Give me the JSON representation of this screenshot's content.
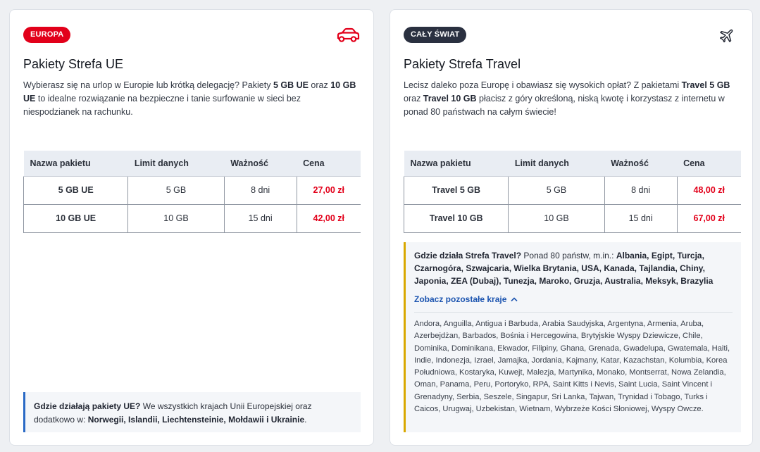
{
  "cards": {
    "eu": {
      "badge": "EUROPA",
      "icon": "car-icon",
      "title": "Pakiety Strefa UE",
      "desc": [
        {
          "t": "Wybierasz się na urlop w Europie lub krótką delegację? Pakiety ",
          "b": false
        },
        {
          "t": "5 GB UE",
          "b": true
        },
        {
          "t": " oraz ",
          "b": false
        },
        {
          "t": "10 GB UE",
          "b": true
        },
        {
          "t": " to idealne rozwiązanie na bezpieczne i tanie surfowanie w sieci bez niespodzianek na rachunku.",
          "b": false
        }
      ],
      "table": {
        "headers": [
          "Nazwa pakietu",
          "Limit danych",
          "Ważność",
          "Cena"
        ],
        "rows": [
          [
            "5 GB UE",
            "5 GB",
            "8 dni",
            "27,00 zł"
          ],
          [
            "10 GB UE",
            "10 GB",
            "15 dni",
            "42,00 zł"
          ]
        ]
      },
      "info": [
        {
          "t": "Gdzie działają pakiety UE?",
          "b": true
        },
        {
          "t": " We wszystkich krajach Unii Europejskiej oraz dodatkowo w: ",
          "b": false
        },
        {
          "t": "Norwegii, Islandii, Liechtensteinie, Mołdawii i Ukrainie",
          "b": true
        },
        {
          "t": ".",
          "b": false
        }
      ]
    },
    "travel": {
      "badge": "CAŁY ŚWIAT",
      "icon": "airplane-icon",
      "title": "Pakiety Strefa Travel",
      "desc": [
        {
          "t": "Lecisz daleko poza Europę i obawiasz się wysokich opłat? Z pakietami ",
          "b": false
        },
        {
          "t": "Travel 5 GB",
          "b": true
        },
        {
          "t": " oraz ",
          "b": false
        },
        {
          "t": "Travel 10 GB",
          "b": true
        },
        {
          "t": " płacisz z góry określoną, niską kwotę i korzystasz z internetu w ponad 80 państwach na całym świecie!",
          "b": false
        }
      ],
      "table": {
        "headers": [
          "Nazwa pakietu",
          "Limit danych",
          "Ważność",
          "Cena"
        ],
        "rows": [
          [
            "Travel 5 GB",
            "5 GB",
            "8 dni",
            "48,00 zł"
          ],
          [
            "Travel 10 GB",
            "10 GB",
            "15 dni",
            "67,00 zł"
          ]
        ]
      },
      "info": [
        {
          "t": "Gdzie działa Strefa Travel?",
          "b": true
        },
        {
          "t": " Ponad 80 państw, m.in.: ",
          "b": false
        },
        {
          "t": "Albania, Egipt, Turcja, Czarnogóra, Szwajcaria, Wielka Brytania, USA, Kanada, Tajlandia, Chiny, Japonia, ZEA (Dubaj), Tunezja, Maroko, Gruzja, Australia, Meksyk, Brazylia",
          "b": true
        }
      ],
      "toggle_label": "Zobacz pozostałe kraje",
      "toggle_icon": "chevron-up-icon",
      "countries": "Andora, Anguilla, Antigua i Barbuda, Arabia Saudyjska, Argentyna, Armenia, Aruba, Azerbejdżan, Barbados, Bośnia i Hercegowina, Brytyjskie Wyspy Dziewicze, Chile, Dominika, Dominikana, Ekwador, Filipiny, Ghana, Grenada, Gwadelupa, Gwatemala, Haiti, Indie, Indonezja, Izrael, Jamajka, Jordania, Kajmany, Katar, Kazachstan, Kolumbia, Korea Południowa, Kostaryka, Kuwejt, Malezja, Martynika, Monako, Montserrat, Nowa Zelandia, Oman, Panama, Peru, Portoryko, RPA, Saint Kitts i Nevis, Saint Lucia, Saint Vincent i Grenadyny, Serbia, Seszele, Singapur, Sri Lanka, Tajwan, Trynidad i Tobago, Turks i Caicos, Urugwaj, Uzbekistan, Wietnam, Wybrzeże Kości Słoniowej, Wyspy Owcze."
    }
  },
  "colors": {
    "brand_red": "#e2001a",
    "dark_badge": "#2a3040",
    "eu_accent": "#2a6ac5",
    "travel_accent": "#d9a800",
    "link_blue": "#1d55b0"
  }
}
